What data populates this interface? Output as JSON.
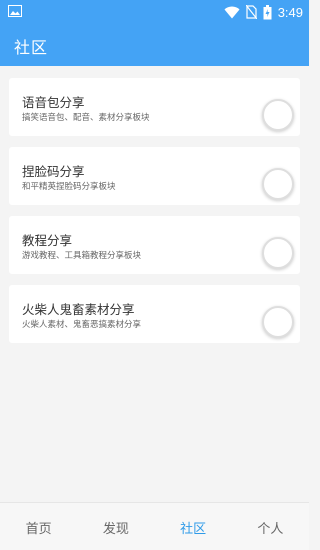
{
  "status_bar": {
    "time": "3:49",
    "accent": "#44a3f5"
  },
  "toolbar": {
    "title": "社区"
  },
  "cards": [
    {
      "title": "语音包分享",
      "desc": "搞笑语音包、配音、素材分享板块"
    },
    {
      "title": "捏脸码分享",
      "desc": "和平精英捏脸码分享板块"
    },
    {
      "title": "教程分享",
      "desc": "游戏教程、工具箱教程分享板块"
    },
    {
      "title": "火柴人鬼畜素材分享",
      "desc": "火柴人素材、鬼畜恶搞素材分享"
    }
  ],
  "bottom_nav": {
    "items": [
      {
        "label": "首页"
      },
      {
        "label": "发现"
      },
      {
        "label": "社区"
      },
      {
        "label": "个人"
      }
    ],
    "active_index": 2,
    "active_color": "#2f9be8"
  }
}
